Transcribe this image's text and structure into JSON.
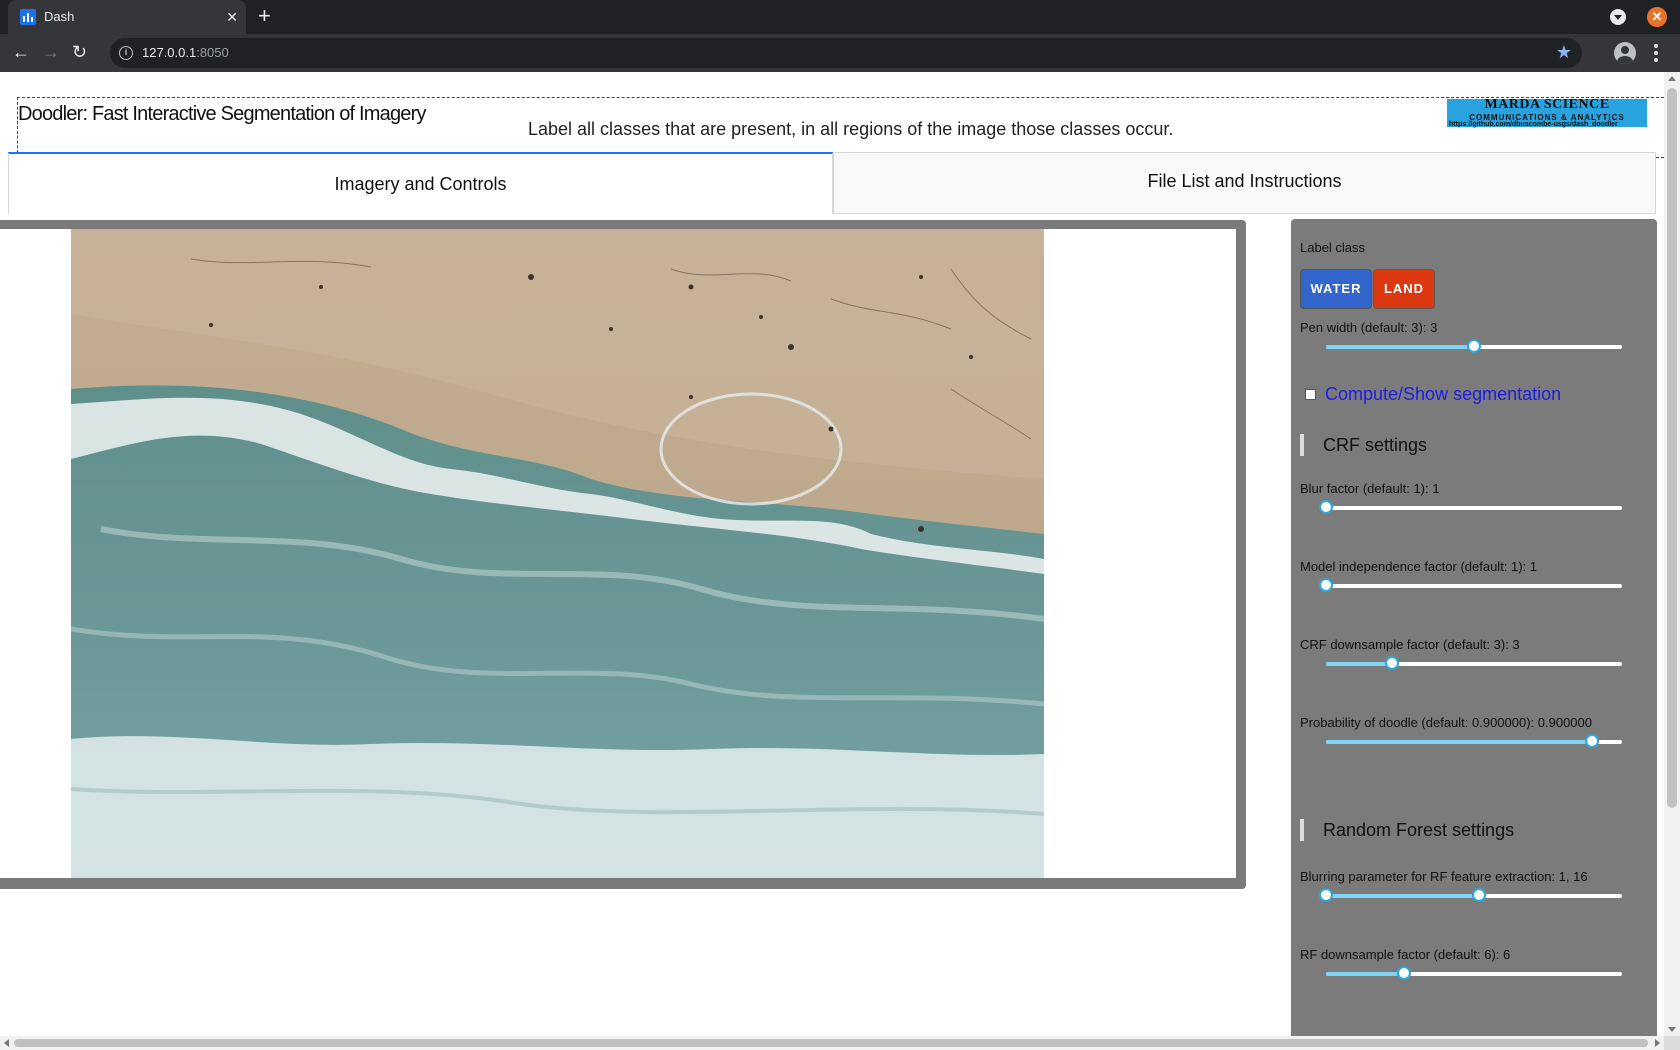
{
  "browser": {
    "tab_title": "Dash",
    "url_host": "127.0.0.1",
    "url_port": ":8050"
  },
  "header": {
    "title": "Doodler: Fast Interactive Segmentation of Imagery",
    "instruction": "Label all classes that are present, in all regions of the image those classes occur.",
    "logo_line1": "MARDA SCIENCE",
    "logo_line2": "COMMUNICATIONS & ANALYTICS",
    "logo_url": "https://github.com/dbuscombe-usgs/dash_doodler"
  },
  "tabs": [
    {
      "label": "Imagery and Controls",
      "active": true
    },
    {
      "label": "File List and Instructions",
      "active": false
    }
  ],
  "controls": {
    "label_class_title": "Label class",
    "classes": [
      {
        "label": "WATER",
        "color": "#3366cc"
      },
      {
        "label": "LAND",
        "color": "#dc3912"
      }
    ],
    "pen_width": {
      "label": "Pen width (default: 3): 3",
      "value": 3,
      "min": 1,
      "max": 5
    },
    "segmentation_checkbox": {
      "label": "Compute/Show segmentation",
      "checked": false
    },
    "crf_title": "CRF settings",
    "blur": {
      "label": "Blur factor (default: 1): 1",
      "value": 1,
      "min": 1,
      "max": 10
    },
    "model_independence": {
      "label": "Model independence factor (default: 1): 1",
      "value": 1,
      "min": 1,
      "max": 10
    },
    "crf_downsample": {
      "label": "CRF downsample factor (default: 3): 3",
      "value": 3,
      "min": 1,
      "max": 10
    },
    "prob_doodle": {
      "label": "Probability of doodle (default: 0.900000): 0.900000",
      "value": 0.9,
      "min": 0,
      "max": 1
    },
    "rf_title": "Random Forest settings",
    "rf_blur": {
      "label": "Blurring parameter for RF feature extraction: 1, 16",
      "low": 1,
      "high": 16,
      "min": 1,
      "max": 30
    },
    "rf_downsample": {
      "label": "RF downsample factor (default: 6): 6",
      "value": 6,
      "min": 1,
      "max": 20
    }
  },
  "colors": {
    "tab_accent": "#1975fa",
    "panel_bg": "#7b7b7b",
    "slider_fill": "#7fd4f5",
    "slider_handle": "#2ca6d9",
    "checkbox_label": "#1d1de8"
  }
}
